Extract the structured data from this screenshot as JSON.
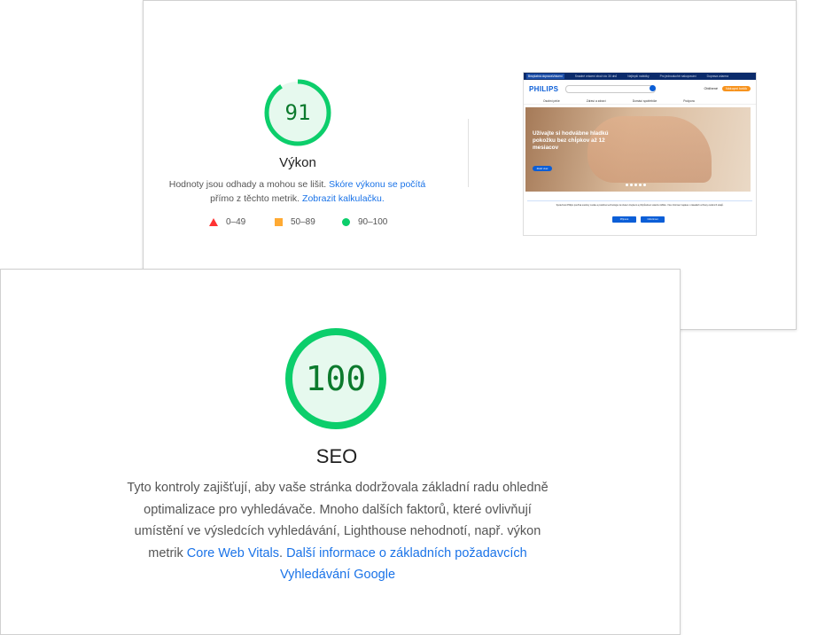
{
  "performance": {
    "score": "91",
    "score_color": "#0cce6b",
    "score_fraction": 0.91,
    "title": "Výkon",
    "desc_prefix": "Hodnoty jsou odhady a mohou se lišit. ",
    "desc_link1": "Skóre výkonu se počítá",
    "desc_mid": " přímo z těchto metrik. ",
    "desc_link2": "Zobrazit kalkulačku.",
    "legend": [
      {
        "icon": "triangle-red",
        "label": "0–49",
        "color": "#ff3333"
      },
      {
        "icon": "square-orange",
        "label": "50–89",
        "color": "#ffaa33"
      },
      {
        "icon": "circle-green",
        "label": "90–100",
        "color": "#0cce6b"
      }
    ]
  },
  "thumbnail": {
    "topbar_badge": "Bezplatná dopravaVrácení",
    "topbar_items": [
      "Snadné vrácení zboží do 30 dnů",
      "Nejlepší nabídky",
      "Pro jednoduché nakupování",
      "Doprava zdarma"
    ],
    "logo": "PHILIPS",
    "search_placeholder": "Hledat produkty",
    "wishlist": "Oblíbené",
    "cart": "Nákupní košík",
    "nav": [
      "Osobní péče",
      "Zdraví a zdraví",
      "Domácí spotřebiče",
      "Podpora"
    ],
    "hero_text": "Užívajte si hodvábne hladkú pokožku bez chĺpkov až 12 mesiacov",
    "hero_button": "Zistiť viac",
    "cookie_text": "Společnost Philips používá soubory cookie a podobné technologie za účelem zlepšení a přizpůsobení vašeho zážitku. Více informací najdete v zásadách ochrany osobních údajů.",
    "cookie_accept": "Přijmout",
    "cookie_reject": "Odmítnout"
  },
  "seo": {
    "score": "100",
    "score_color": "#0cce6b",
    "score_fraction": 1.0,
    "title": "SEO",
    "desc_text": "Tyto kontroly zajišťují, aby vaše stránka dodržovala základní radu ohledně optimalizace pro vyhledávače. Mnoho dalších faktorů, které ovlivňují umístění ve výsledcích vyhledávání, Lighthouse nehodnotí, např. výkon metrik ",
    "desc_link1": "Core Web Vitals",
    "desc_mid": ". ",
    "desc_link2": "Další informace o základních požadavcích Vyhledávání Google"
  }
}
